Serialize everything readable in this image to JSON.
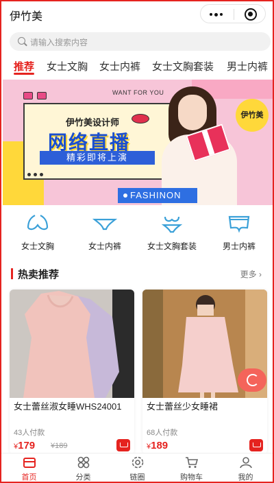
{
  "app": {
    "title": "伊竹美"
  },
  "search": {
    "placeholder": "请输入搜索内容"
  },
  "tabs": [
    {
      "label": "推荐",
      "active": true
    },
    {
      "label": "女士文胸",
      "active": false
    },
    {
      "label": "女士内裤",
      "active": false
    },
    {
      "label": "女士文胸套装",
      "active": false
    },
    {
      "label": "男士内裤",
      "active": false
    }
  ],
  "banner": {
    "want": "WANT FOR YOU",
    "designer": "伊竹美设计师",
    "headline": "网络直播",
    "sub": "精彩即将上演",
    "brand": "伊竹美",
    "fashion": "FASHINON"
  },
  "categories": [
    {
      "label": "女士文胸",
      "icon": "bra-icon"
    },
    {
      "label": "女士内裤",
      "icon": "panties-icon"
    },
    {
      "label": "女士文胸套装",
      "icon": "lingerie-set-icon"
    },
    {
      "label": "男士内裤",
      "icon": "briefs-icon"
    }
  ],
  "section": {
    "title": "热卖推荐",
    "more": "更多"
  },
  "products": [
    {
      "name": "女士蕾丝淑女睡WHS24001",
      "sold": "43人付款",
      "price": "179",
      "original": "¥189"
    },
    {
      "name": "女士蕾丝少女睡裙",
      "sold": "68人付款",
      "price": "189",
      "original": ""
    }
  ],
  "tabbar": [
    {
      "label": "首页",
      "icon": "home-icon",
      "active": true
    },
    {
      "label": "分类",
      "icon": "category-icon",
      "active": false
    },
    {
      "label": "链圈",
      "icon": "circle-icon",
      "active": false
    },
    {
      "label": "购物车",
      "icon": "cart-icon",
      "active": false
    },
    {
      "label": "我的",
      "icon": "user-icon",
      "active": false
    }
  ],
  "colors": {
    "accent": "#e5231f",
    "banner_blue": "#2e6fe2",
    "banner_pink": "#f7c5d8",
    "banner_yellow": "#ffd83a"
  }
}
